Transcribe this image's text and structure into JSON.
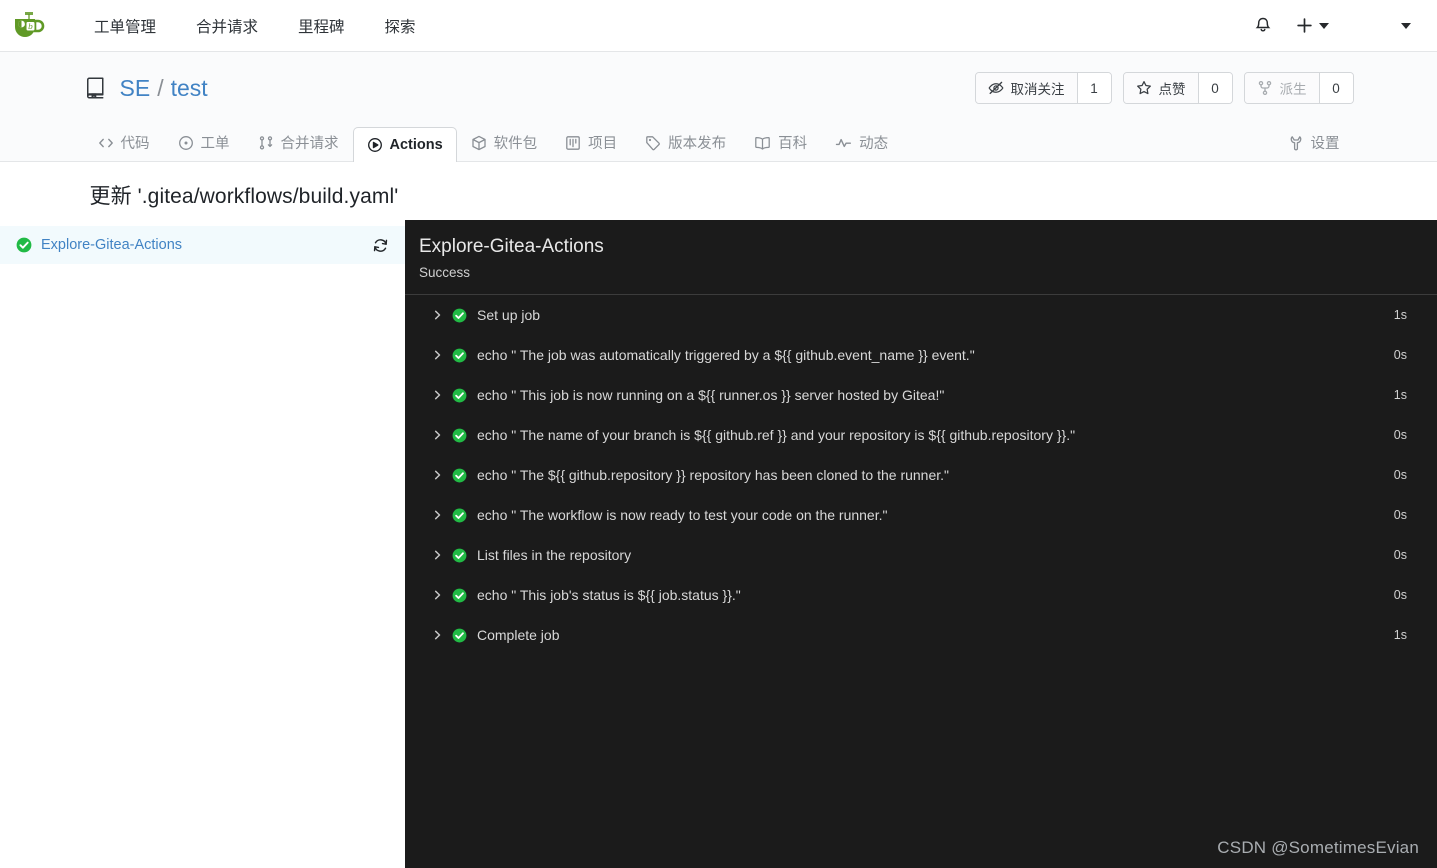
{
  "navbar": {
    "logo_icon": "gitea-teacup-logo",
    "links": [
      {
        "label": "工单管理",
        "name": "nav-link-issues"
      },
      {
        "label": "合并请求",
        "name": "nav-link-pulls"
      },
      {
        "label": "里程碑",
        "name": "nav-link-milestones"
      },
      {
        "label": "探索",
        "name": "nav-link-explore"
      }
    ],
    "notification_icon": "bell-icon",
    "create_icon": "plus-icon",
    "create_caret_icon": "caret-down-icon",
    "avatar_caret_icon": "caret-down-icon"
  },
  "repo": {
    "icon": "repository-icon",
    "owner": "SE",
    "separator": "/",
    "name": "test",
    "actions": [
      {
        "name": "watch-button",
        "icon": "eye-slash-icon",
        "label": "取消关注",
        "count": "1",
        "disabled": false
      },
      {
        "name": "star-button",
        "icon": "star-icon",
        "label": "点赞",
        "count": "0",
        "disabled": false
      },
      {
        "name": "fork-button",
        "icon": "fork-icon",
        "label": "派生",
        "count": "0",
        "disabled": true
      }
    ],
    "tabs": [
      {
        "label": "代码",
        "icon": "code-icon",
        "name": "tab-code",
        "active": false
      },
      {
        "label": "工单",
        "icon": "issue-opened-icon",
        "name": "tab-issues",
        "active": false
      },
      {
        "label": "合并请求",
        "icon": "git-pull-request-icon",
        "name": "tab-pulls",
        "active": false
      },
      {
        "label": "Actions",
        "icon": "play-circle-icon",
        "name": "tab-actions",
        "active": true
      },
      {
        "label": "软件包",
        "icon": "package-icon",
        "name": "tab-packages",
        "active": false
      },
      {
        "label": "项目",
        "icon": "project-icon",
        "name": "tab-projects",
        "active": false
      },
      {
        "label": "版本发布",
        "icon": "tag-icon",
        "name": "tab-releases",
        "active": false
      },
      {
        "label": "百科",
        "icon": "book-icon",
        "name": "tab-wiki",
        "active": false
      },
      {
        "label": "动态",
        "icon": "pulse-icon",
        "name": "tab-activity",
        "active": false
      }
    ],
    "settings_tab": {
      "label": "设置",
      "icon": "wrench-icon",
      "name": "tab-settings"
    }
  },
  "run": {
    "title": "更新 '.gitea/workflows/build.yaml'",
    "jobs": [
      {
        "name": "Explore-Gitea-Actions",
        "status": "success",
        "status_icon": "check-circle-icon",
        "rerun_icon": "rerun-icon",
        "selected": true
      }
    ],
    "detail": {
      "title": "Explore-Gitea-Actions",
      "status": "Success",
      "steps": [
        {
          "name": "Set up job",
          "duration": "1s",
          "status": "success"
        },
        {
          "name": "echo \" The job was automatically triggered by a ${{ github.event_name }} event.\"",
          "duration": "0s",
          "status": "success"
        },
        {
          "name": "echo \" This job is now running on a ${{ runner.os }} server hosted by Gitea!\"",
          "duration": "1s",
          "status": "success"
        },
        {
          "name": "echo \" The name of your branch is ${{ github.ref }} and your repository is ${{ github.repository }}.\"",
          "duration": "0s",
          "status": "success"
        },
        {
          "name": "echo \" The ${{ github.repository }} repository has been cloned to the runner.\"",
          "duration": "0s",
          "status": "success"
        },
        {
          "name": "echo \" The workflow is now ready to test your code on the runner.\"",
          "duration": "0s",
          "status": "success"
        },
        {
          "name": "List files in the repository",
          "duration": "0s",
          "status": "success"
        },
        {
          "name": "echo \" This job's status is ${{ job.status }}.\"",
          "duration": "0s",
          "status": "success"
        },
        {
          "name": "Complete job",
          "duration": "1s",
          "status": "success"
        }
      ]
    }
  },
  "watermark": "CSDN @SometimesEvian",
  "colors": {
    "accent_link": "#4183c4",
    "success_green": "#21ba45",
    "panel_dark": "#1b1b1b",
    "selected_job_bg": "#f2fafd"
  }
}
